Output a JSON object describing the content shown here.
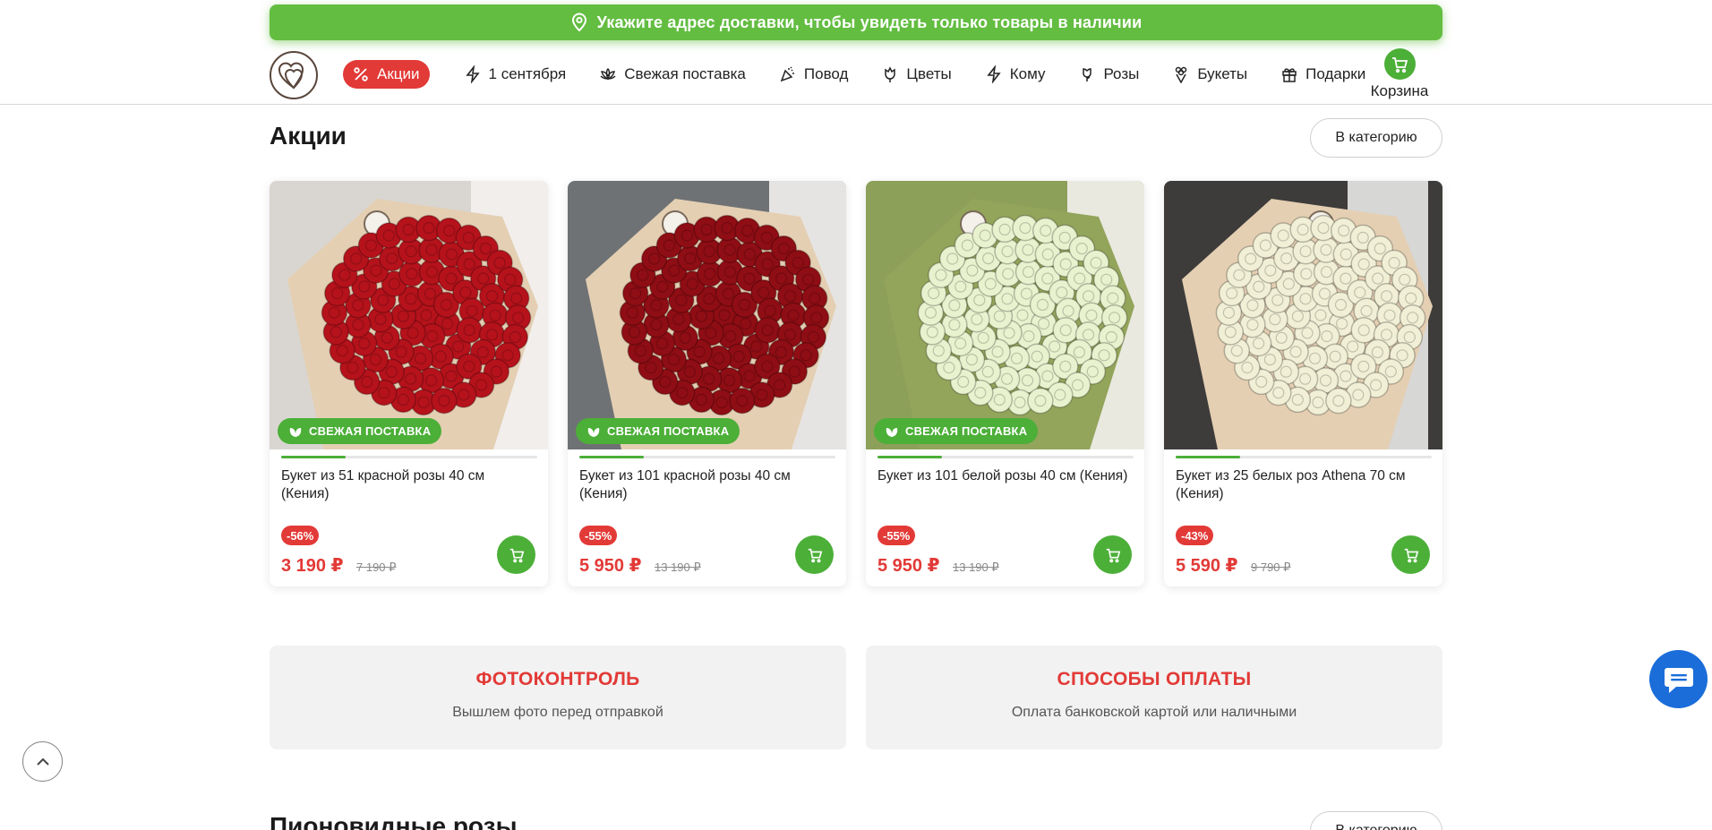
{
  "banner": {
    "text": "Укажите адрес доставки, чтобы увидеть только товары в наличии",
    "icon": "map-pin-icon"
  },
  "nav": {
    "items": [
      {
        "label": "Акции",
        "icon": "percent-icon"
      },
      {
        "label": "1 сентября",
        "icon": "lightning-icon"
      },
      {
        "label": "Свежая поставка",
        "icon": "lotus-icon"
      },
      {
        "label": "Повод",
        "icon": "party-popper-icon"
      },
      {
        "label": "Цветы",
        "icon": "tulip-icon"
      },
      {
        "label": "Кому",
        "icon": "lightning-icon"
      },
      {
        "label": "Розы",
        "icon": "rose-icon"
      },
      {
        "label": "Букеты",
        "icon": "bouquet-icon"
      },
      {
        "label": "Подарки",
        "icon": "gift-icon"
      }
    ],
    "cart_label": "Корзина"
  },
  "section": {
    "title": "Акции",
    "category_button": "В категорию"
  },
  "products": [
    {
      "fresh_label": "СВЕЖАЯ ПОСТАВКА",
      "show_fresh": true,
      "title": "Букет из 51 красной розы 40 см (Кения)",
      "discount": "-56%",
      "price": "3 190 ₽",
      "old_price": "7 190 ₽",
      "progress": 0.25,
      "flower_color": "#b5121b",
      "bg": "#d9d6d1"
    },
    {
      "fresh_label": "СВЕЖАЯ ПОСТАВКА",
      "show_fresh": true,
      "title": "Букет из 101 красной розы 40 см (Кения)",
      "discount": "-55%",
      "price": "5 950 ₽",
      "old_price": "13 190 ₽",
      "progress": 0.25,
      "flower_color": "#8f0d14",
      "bg": "#6f7274"
    },
    {
      "fresh_label": "СВЕЖАЯ ПОСТАВКА",
      "show_fresh": true,
      "title": "Букет из 101 белой розы 40 см (Кения)",
      "discount": "-55%",
      "price": "5 950 ₽",
      "old_price": "13 190 ₽",
      "progress": 0.25,
      "flower_color": "#e9f2cf",
      "bg": "#8da05a"
    },
    {
      "fresh_label": "",
      "show_fresh": false,
      "title": "Букет из 25 белых роз Athena 70 см (Кения)",
      "discount": "-43%",
      "price": "5 590 ₽",
      "old_price": "9 790 ₽",
      "progress": 0.25,
      "flower_color": "#f1f0d6",
      "bg": "#3e3c3a"
    }
  ],
  "info": [
    {
      "title": "ФОТОКОНТРОЛЬ",
      "subtitle": "Вышлем фото перед отправкой"
    },
    {
      "title": "СПОСОБЫ ОПЛАТЫ",
      "subtitle": "Оплата банковской картой или наличными"
    }
  ],
  "next_section": {
    "title": "Пионовидные розы",
    "category_button": "В категорию"
  },
  "colors": {
    "green": "#63bd41",
    "accent_green": "#4caf38",
    "red": "#e23a37",
    "chat_blue": "#1b6dd9"
  }
}
